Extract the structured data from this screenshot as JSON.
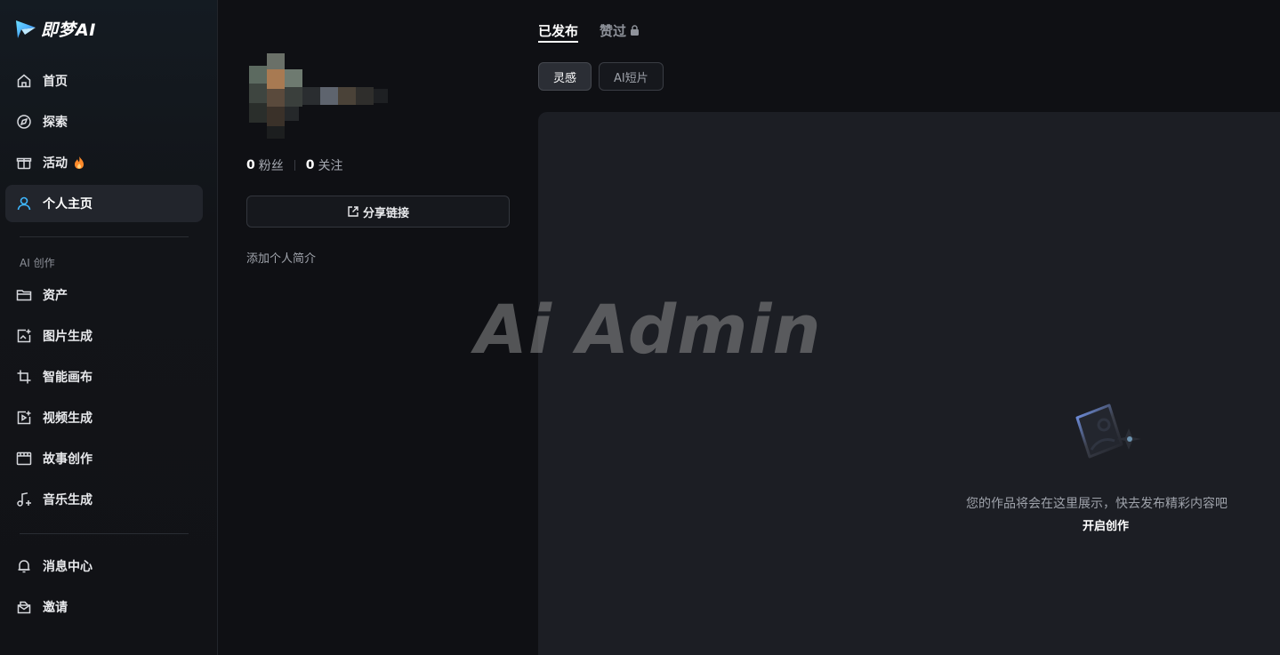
{
  "app": {
    "logo_text": "即梦AI"
  },
  "sidebar": {
    "items": [
      {
        "label": "首页",
        "icon": "home-icon"
      },
      {
        "label": "探索",
        "icon": "compass-icon"
      },
      {
        "label": "活动",
        "icon": "gift-icon",
        "badge_icon": "fire-icon"
      },
      {
        "label": "个人主页",
        "icon": "user-icon",
        "active": true
      }
    ],
    "section_title": "AI 创作",
    "create_items": [
      {
        "label": "资产",
        "icon": "folder-icon"
      },
      {
        "label": "图片生成",
        "icon": "image-plus-icon"
      },
      {
        "label": "智能画布",
        "icon": "canvas-crop-icon"
      },
      {
        "label": "视频生成",
        "icon": "video-plus-icon"
      },
      {
        "label": "故事创作",
        "icon": "storyboard-icon"
      },
      {
        "label": "音乐生成",
        "icon": "music-plus-icon"
      }
    ],
    "bottom_items": [
      {
        "label": "消息中心",
        "icon": "bell-icon"
      },
      {
        "label": "邀请",
        "icon": "invite-icon"
      }
    ]
  },
  "profile": {
    "followers_count": "0",
    "followers_label": "粉丝",
    "following_count": "0",
    "following_label": "关注",
    "share_label": "分享链接",
    "bio_placeholder": "添加个人简介"
  },
  "tabs": [
    {
      "label": "已发布",
      "active": true
    },
    {
      "label": "赞过",
      "locked": true
    }
  ],
  "filters": [
    {
      "label": "灵感",
      "active": true
    },
    {
      "label": "AI短片"
    }
  ],
  "empty_state": {
    "message": "您的作品将会在这里展示，快去发布精彩内容吧",
    "action": "开启创作"
  },
  "watermark": "Ai Admin",
  "colors": {
    "accent": "#3fb8ff",
    "fire": "#ff8a2a",
    "panel": "#1c1e24"
  }
}
